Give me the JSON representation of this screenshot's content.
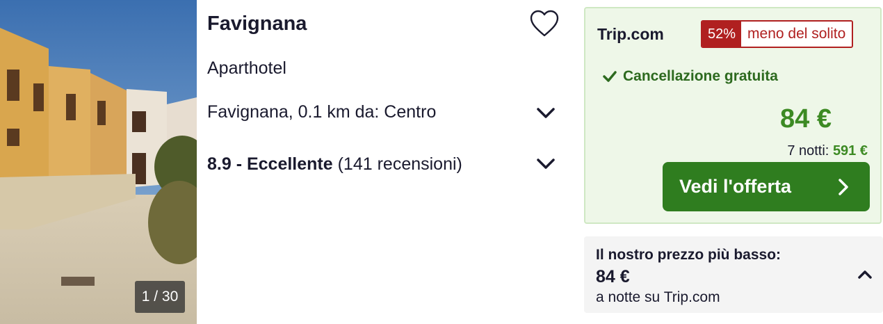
{
  "photo": {
    "counter": "1 / 30"
  },
  "hotel": {
    "name": "Favignana",
    "type": "Aparthotel",
    "location": "Favignana, 0.1 km da: Centro",
    "rating_score": "8.9 - Eccellente",
    "rating_reviews": " (141 recensioni)"
  },
  "offer": {
    "provider": "Trip.com",
    "badge_percent": "52%",
    "badge_text": "meno del solito",
    "cancellation": "Cancellazione gratuita",
    "price": "84 €",
    "nights_label": "7 notti: ",
    "nights_total": "591 €",
    "cta_label": "Vedi l'offerta"
  },
  "lowest": {
    "title": "Il nostro prezzo più basso:",
    "price": "84 €",
    "subtitle": "a notte su Trip.com"
  },
  "colors": {
    "brand_green": "#2f7d1f",
    "price_green": "#3c8a23",
    "badge_red": "#b02020",
    "offer_bg": "#eef7e8"
  },
  "icons": [
    "heart-icon",
    "chevron-down-icon",
    "check-icon",
    "chevron-right-icon",
    "chevron-up-icon"
  ]
}
